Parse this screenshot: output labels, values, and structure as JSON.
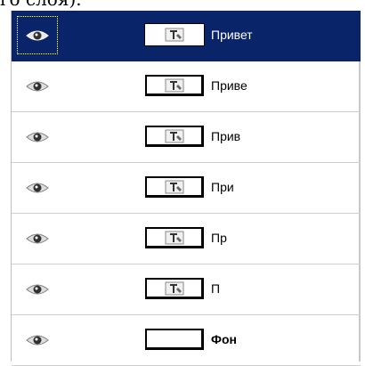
{
  "caption": "го слоя).",
  "layers": [
    {
      "name": "Привет",
      "selected": true,
      "visible": true,
      "has_text_icon": true
    },
    {
      "name": "Приве",
      "selected": false,
      "visible": true,
      "has_text_icon": true
    },
    {
      "name": "Прив",
      "selected": false,
      "visible": true,
      "has_text_icon": true
    },
    {
      "name": "При",
      "selected": false,
      "visible": true,
      "has_text_icon": true
    },
    {
      "name": "Пр",
      "selected": false,
      "visible": true,
      "has_text_icon": true
    },
    {
      "name": "П",
      "selected": false,
      "visible": true,
      "has_text_icon": true
    },
    {
      "name": "Фон",
      "selected": false,
      "visible": true,
      "has_text_icon": false
    }
  ],
  "colors": {
    "selection": "#0a246a",
    "background": "#ffffff"
  },
  "icons": {
    "visibility": "eye-icon",
    "text_layer": "text-layer-icon"
  }
}
